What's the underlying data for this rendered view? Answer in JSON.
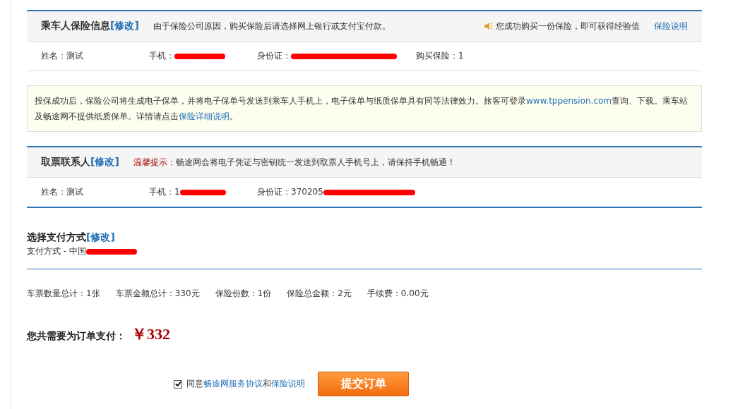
{
  "insurance": {
    "title": "乘车人保险信息",
    "edit": "[修改]",
    "note": "由于保险公司原因，购买保险后请选择网上银行或支付宝付款。",
    "reward": "您成功购买一份保险，即可获得经验值",
    "link": "保险说明",
    "fields": [
      {
        "text": "姓名：测试",
        "redacted": false
      },
      {
        "text": "手机：",
        "redacted": true
      },
      {
        "text": "身份证：",
        "redacted": true
      },
      {
        "text": "购买保险：1",
        "redacted": false
      }
    ]
  },
  "notice": {
    "parts": [
      {
        "text": "投保成功后，保险公司将生成电子保单，并将电子保单号发送到乘车人手机上，电子保单与纸质保单具有同等法律效力。旅客可登录",
        "kind": "text"
      },
      {
        "text": "www.tppension.com",
        "kind": "link"
      },
      {
        "text": "查询、下载。乘车站及畅途网不提供纸质保单。详情请点击",
        "kind": "text"
      },
      {
        "text": "保险详细说明",
        "kind": "link"
      },
      {
        "text": "。",
        "kind": "text"
      }
    ]
  },
  "contact": {
    "title": "取票联系人",
    "edit": "[修改]",
    "tip_label": "温馨提示：",
    "tip": "畅途网会将电子凭证与密钥统一发送到取票人手机号上，请保持手机畅通！",
    "fields": [
      {
        "text": "姓名：测试",
        "redacted": false
      },
      {
        "text": "手机：1",
        "redacted": true
      },
      {
        "text": "身份证：370205",
        "redacted": true
      }
    ]
  },
  "payment": {
    "title": "选择支付方式",
    "edit": "[修改]",
    "method": "支付方式 - 中国",
    "redacted": true
  },
  "totals": [
    "车票数量总计：1张",
    "车票金额总计：330元",
    "保险份数：1份",
    "保险总金额：2元",
    "手续费：0.00元"
  ],
  "total_label": "您共需要为订单支付：",
  "total_amount": "￥332",
  "agree": {
    "checked": true,
    "parts": [
      {
        "text": "同意",
        "kind": "text"
      },
      {
        "text": "畅途网服务协议",
        "kind": "link"
      },
      {
        "text": "和",
        "kind": "text"
      },
      {
        "text": "保险说明",
        "kind": "link"
      }
    ]
  },
  "submit": "提交订单"
}
